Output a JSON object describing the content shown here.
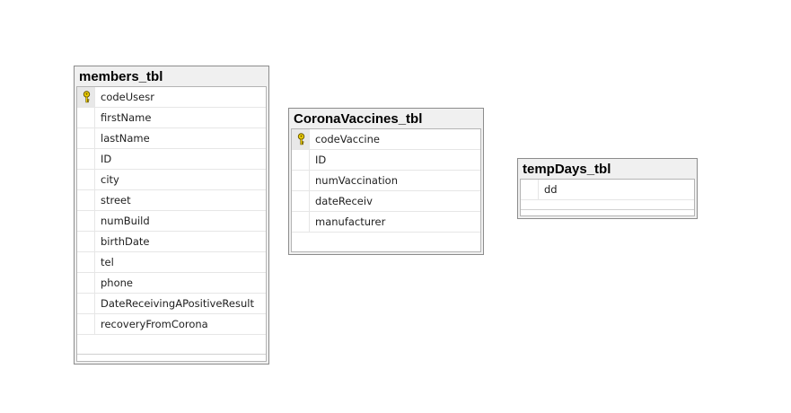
{
  "tables": {
    "members": {
      "title": "members_tbl",
      "columns": [
        {
          "name": "codeUsesr",
          "key": true
        },
        {
          "name": "firstName",
          "key": false
        },
        {
          "name": "lastName",
          "key": false
        },
        {
          "name": "ID",
          "key": false
        },
        {
          "name": "city",
          "key": false
        },
        {
          "name": "street",
          "key": false
        },
        {
          "name": "numBuild",
          "key": false
        },
        {
          "name": "birthDate",
          "key": false
        },
        {
          "name": "tel",
          "key": false
        },
        {
          "name": "phone",
          "key": false
        },
        {
          "name": "DateReceivingAPositiveResult",
          "key": false
        },
        {
          "name": "recoveryFromCorona",
          "key": false
        }
      ]
    },
    "corona": {
      "title": "CoronaVaccines_tbl",
      "columns": [
        {
          "name": "codeVaccine",
          "key": true
        },
        {
          "name": "ID",
          "key": false
        },
        {
          "name": "numVaccination",
          "key": false
        },
        {
          "name": "dateReceiv",
          "key": false
        },
        {
          "name": "manufacturer",
          "key": false
        }
      ]
    },
    "tempdays": {
      "title": "tempDays_tbl",
      "columns": [
        {
          "name": "dd",
          "key": false
        }
      ]
    }
  },
  "colors": {
    "header_bg": "#f0f0f0",
    "border": "#8c8c8c",
    "key_icon": "#f2d100"
  },
  "icons": {
    "primary_key": "key-icon"
  }
}
